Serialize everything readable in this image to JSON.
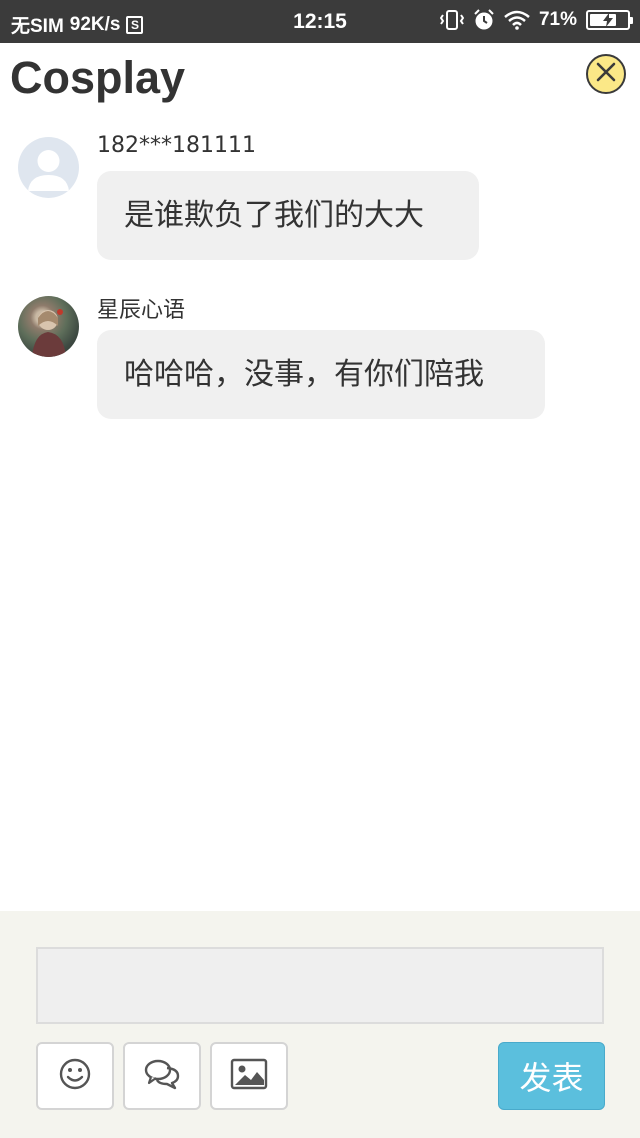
{
  "status_bar": {
    "carrier": "无SIM",
    "net_speed": "92K/s",
    "sim_badge": "S",
    "time": "12:15",
    "battery": "71%",
    "battery_level": 0.71,
    "icons": [
      "vibrate-icon",
      "alarm-icon",
      "wifi-icon",
      "battery-icon"
    ]
  },
  "header": {
    "title": "Cosplay",
    "close_icon": "close-icon",
    "close_color": "#fbe887"
  },
  "messages": [
    {
      "username": "182***181111",
      "text": "是谁欺负了我们的大大",
      "avatar": "default-avatar"
    },
    {
      "username": "星辰心语",
      "text": "哈哈哈，没事，有你们陪我",
      "avatar": "photo-avatar"
    }
  ],
  "composer": {
    "input_value": "",
    "placeholder": "",
    "tools": [
      "emoji-icon",
      "chat-bubbles-icon",
      "image-icon"
    ],
    "send_label": "发表",
    "send_color": "#5bbfdd"
  }
}
